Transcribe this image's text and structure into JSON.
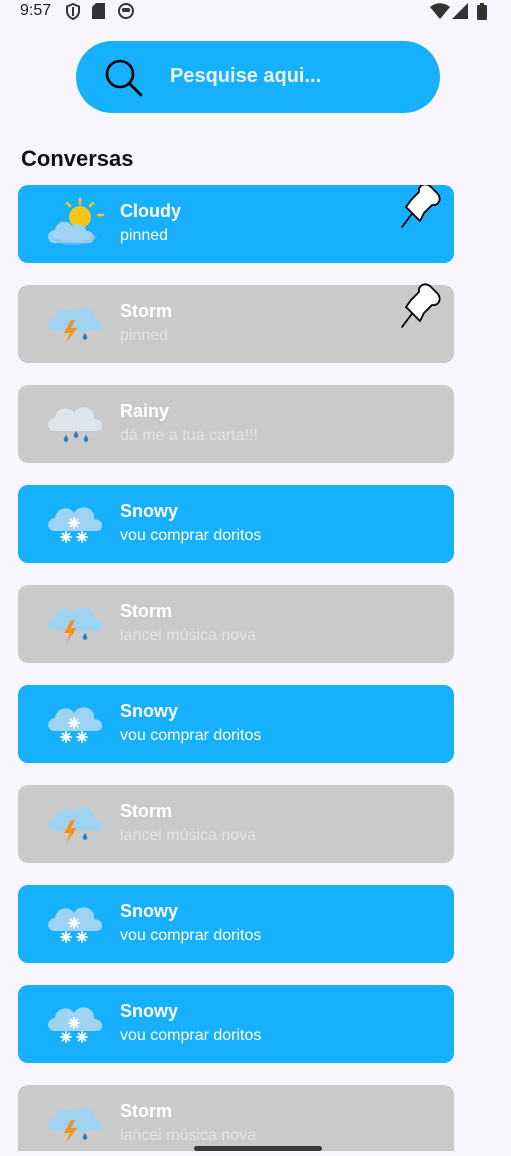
{
  "status": {
    "time": "9:57"
  },
  "search": {
    "placeholder": "Pesquise aqui..."
  },
  "section_title": "Conversas",
  "conversations": [
    {
      "title": "Cloudy",
      "subtitle": "pinned",
      "weather": "cloudy-sun-icon",
      "pinned": true,
      "active": true
    },
    {
      "title": "Storm",
      "subtitle": "pinned",
      "weather": "storm-icon",
      "pinned": true,
      "active": false
    },
    {
      "title": "Rainy",
      "subtitle": "dá me a tua carta!!!",
      "weather": "rain-icon",
      "pinned": false,
      "active": false
    },
    {
      "title": "Snowy",
      "subtitle": "vou comprar doritos",
      "weather": "snow-icon",
      "pinned": false,
      "active": true
    },
    {
      "title": "Storm",
      "subtitle": "lancei música nova",
      "weather": "storm-icon",
      "pinned": false,
      "active": false
    },
    {
      "title": "Snowy",
      "subtitle": "vou comprar doritos",
      "weather": "snow-icon",
      "pinned": false,
      "active": true
    },
    {
      "title": "Storm",
      "subtitle": "lancei música nova",
      "weather": "storm-icon",
      "pinned": false,
      "active": false
    },
    {
      "title": "Snowy",
      "subtitle": "vou comprar doritos",
      "weather": "snow-icon",
      "pinned": false,
      "active": true
    },
    {
      "title": "Snowy",
      "subtitle": "vou comprar doritos",
      "weather": "snow-icon",
      "pinned": false,
      "active": true
    },
    {
      "title": "Storm",
      "subtitle": "lancei música nova",
      "weather": "storm-icon",
      "pinned": false,
      "active": false
    }
  ],
  "colors": {
    "accent": "#17b0fc",
    "inactive": "#cbcacb",
    "background": "#f8f6fc"
  }
}
